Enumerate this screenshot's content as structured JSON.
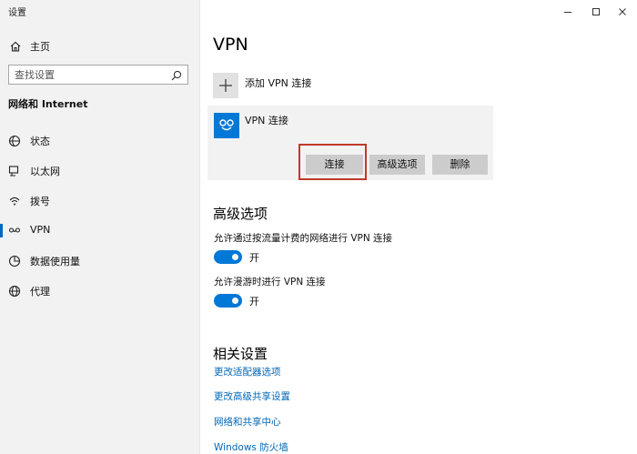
{
  "window": {
    "title": "设置",
    "controls": [
      "minimize",
      "maximize",
      "close"
    ]
  },
  "sidebar": {
    "home_label": "主页",
    "search_placeholder": "查找设置",
    "section_title": "网络和 Internet",
    "items": [
      {
        "label": "状态",
        "icon": "status-icon"
      },
      {
        "label": "以太网",
        "icon": "ethernet-icon"
      },
      {
        "label": "拨号",
        "icon": "dialup-icon"
      },
      {
        "label": "VPN",
        "icon": "vpn-icon",
        "active": true
      },
      {
        "label": "数据使用量",
        "icon": "data-usage-icon"
      },
      {
        "label": "代理",
        "icon": "proxy-icon"
      }
    ]
  },
  "main": {
    "title": "VPN",
    "add_vpn_label": "添加 VPN 连接",
    "vpn_connection": {
      "name": "VPN 连接",
      "buttons": {
        "connect": "连接",
        "advanced": "高级选项",
        "delete": "删除"
      }
    },
    "advanced": {
      "title": "高级选项",
      "options": [
        {
          "label": "允许通过按流量计费的网络进行 VPN 连接",
          "state": "开",
          "on": true
        },
        {
          "label": "允许漫游时进行 VPN 连接",
          "state": "开",
          "on": true
        }
      ]
    },
    "related": {
      "title": "相关设置",
      "links": [
        "更改适配器选项",
        "更改高级共享设置",
        "网络和共享中心",
        "Windows 防火墙"
      ]
    }
  },
  "colors": {
    "accent": "#0078d7",
    "link": "#0067b8",
    "highlight": "#c0392b"
  }
}
